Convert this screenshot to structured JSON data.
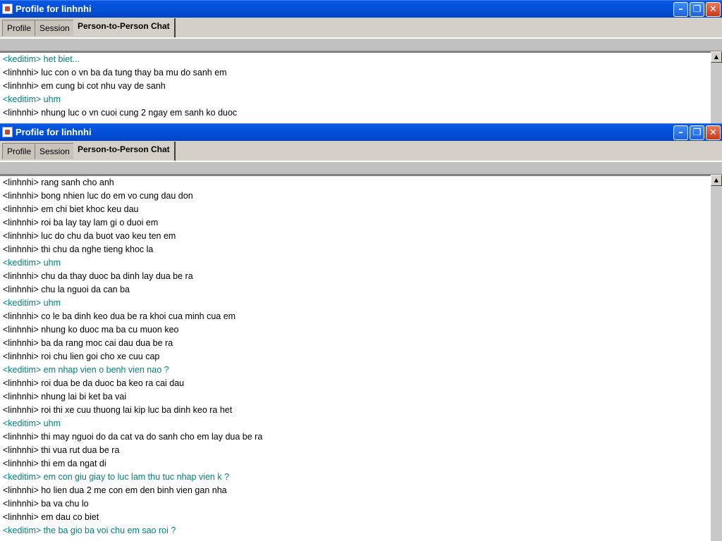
{
  "windows": [
    {
      "title": "Profile for linhnhi",
      "tabs": [
        "Profile",
        "Session",
        "Person-to-Person Chat"
      ],
      "controls": {
        "minimize": "–",
        "maximize": "❐",
        "close": "✕"
      },
      "messages": [
        {
          "who": "me",
          "text": "<keditim> het biet..."
        },
        {
          "who": "them",
          "text": "<linhnhi>  luc con o vn ba da tung thay ba mu do sanh em"
        },
        {
          "who": "them",
          "text": "<linhnhi>  em cung bi cot nhu vay de sanh"
        },
        {
          "who": "me",
          "text": "<keditim> uhm"
        },
        {
          "who": "them",
          "text": "<linhnhi>  nhung luc o vn cuoi cung 2 ngay em sanh ko duoc"
        }
      ]
    },
    {
      "title": "Profile for linhnhi",
      "tabs": [
        "Profile",
        "Session",
        "Person-to-Person Chat"
      ],
      "controls": {
        "minimize": "–",
        "maximize": "❐",
        "close": "✕"
      },
      "messages": [
        {
          "who": "them",
          "text": "<linhnhi>  rang sanh cho anh"
        },
        {
          "who": "them",
          "text": "<linhnhi>  bong nhien luc do em vo cung dau don"
        },
        {
          "who": "them",
          "text": "<linhnhi>  em chi biet khoc keu dau"
        },
        {
          "who": "them",
          "text": "<linhnhi>  roi ba lay tay lam gi o duoi em"
        },
        {
          "who": "them",
          "text": "<linhnhi>  luc do chu da buot vao keu ten em"
        },
        {
          "who": "them",
          "text": "<linhnhi>  thi chu da nghe tieng khoc la"
        },
        {
          "who": "me",
          "text": "<keditim> uhm"
        },
        {
          "who": "them",
          "text": "<linhnhi>  chu da thay duoc ba dinh lay dua be ra"
        },
        {
          "who": "them",
          "text": "<linhnhi>  chu la nguoi da can ba"
        },
        {
          "who": "me",
          "text": "<keditim> uhm"
        },
        {
          "who": "them",
          "text": "<linhnhi>  co le ba dinh keo dua be ra khoi cua minh cua em"
        },
        {
          "who": "them",
          "text": "<linhnhi>  nhung ko duoc ma ba cu muon keo"
        },
        {
          "who": "them",
          "text": "<linhnhi>  ba da rang moc cai dau dua be ra"
        },
        {
          "who": "them",
          "text": "<linhnhi>  roi chu lien goi cho xe cuu cap"
        },
        {
          "who": "me",
          "text": "<keditim> em nhap vien o benh vien nao ?"
        },
        {
          "who": "them",
          "text": "<linhnhi>  roi dua be da duoc ba keo ra cai dau"
        },
        {
          "who": "them",
          "text": "<linhnhi>  nhung lai bi ket ba vai"
        },
        {
          "who": "them",
          "text": "<linhnhi>  roi thi xe cuu thuong lai kip luc ba dinh keo ra het"
        },
        {
          "who": "me",
          "text": "<keditim> uhm"
        },
        {
          "who": "them",
          "text": "<linhnhi>  thi may nguoi do da cat va do sanh cho em lay dua be ra"
        },
        {
          "who": "them",
          "text": "<linhnhi>  thi vua rut dua be ra"
        },
        {
          "who": "them",
          "text": "<linhnhi>  thi em da ngat di"
        },
        {
          "who": "me",
          "text": "<keditim> em con giu giay to luc lam thu tuc nhap vien k ?"
        },
        {
          "who": "them",
          "text": "<linhnhi>  ho lien dua 2 me con em den binh vien gan nha"
        },
        {
          "who": "them",
          "text": "<linhnhi>  ba va chu lo"
        },
        {
          "who": "them",
          "text": "<linhnhi>  em dau co biet"
        },
        {
          "who": "me",
          "text": "<keditim> the ba gio ba voi chu em sao roi ?"
        }
      ]
    }
  ],
  "colors": {
    "titlebar": "#0351d8",
    "me_text": "#008080",
    "them_text": "#000000",
    "chrome": "#d4d0c8"
  },
  "icons": {
    "app": "java-cup-icon",
    "scroll_up": "arrow-up-icon"
  }
}
